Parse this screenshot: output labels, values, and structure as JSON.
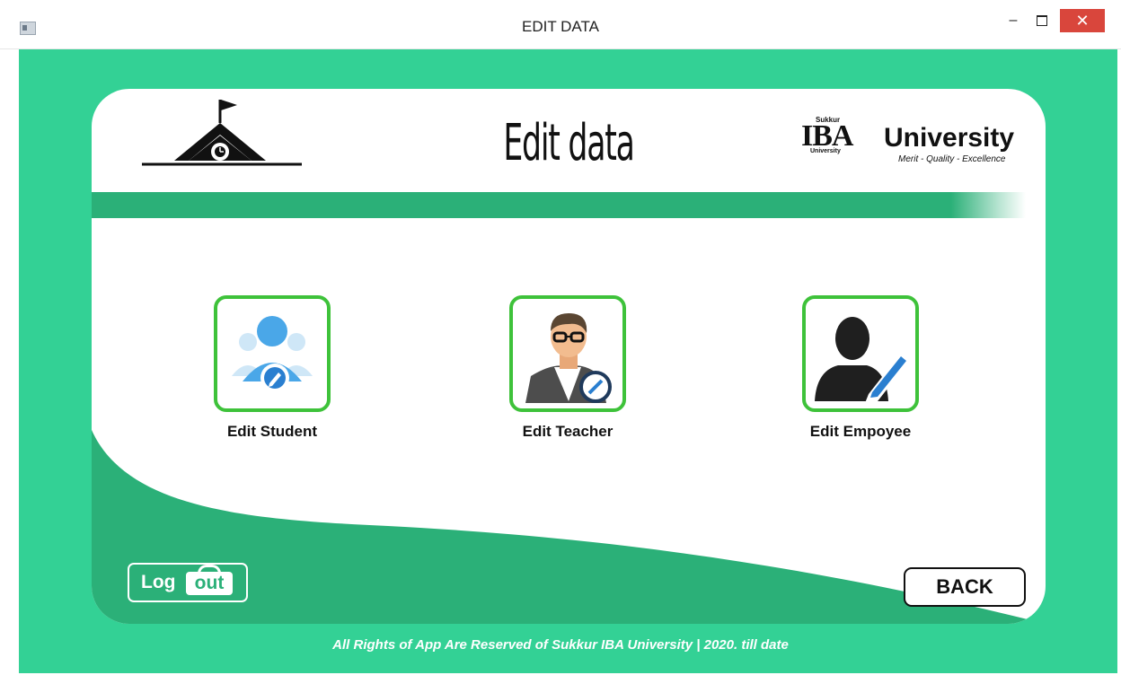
{
  "window": {
    "title": "EDIT DATA",
    "controls": {
      "minimize": "–",
      "maximize": "□",
      "close": "✕"
    }
  },
  "header": {
    "heading": "Edit data",
    "left_logo_icon": "school-house-icon",
    "right_logo": {
      "mark": "IBA",
      "small_top": "Sukkur",
      "small_bottom": "University",
      "name": "University",
      "tagline": "Merit - Quality - Excellence"
    }
  },
  "options": [
    {
      "label": "Edit Student",
      "icon": "edit-student-icon"
    },
    {
      "label": "Edit Teacher",
      "icon": "edit-teacher-icon"
    },
    {
      "label": "Edit Empoyee",
      "icon": "edit-employee-icon"
    }
  ],
  "logout": {
    "left": "Log",
    "right": "out"
  },
  "back": {
    "label": "BACK"
  },
  "footer": {
    "text": "All Rights of App Are Reserved of  Sukkur IBA University   |  2020. till date"
  },
  "colors": {
    "accent": "#33d195",
    "stripe": "#2bb078",
    "tile_border": "#3ec23a",
    "close_button": "#d9463c"
  }
}
